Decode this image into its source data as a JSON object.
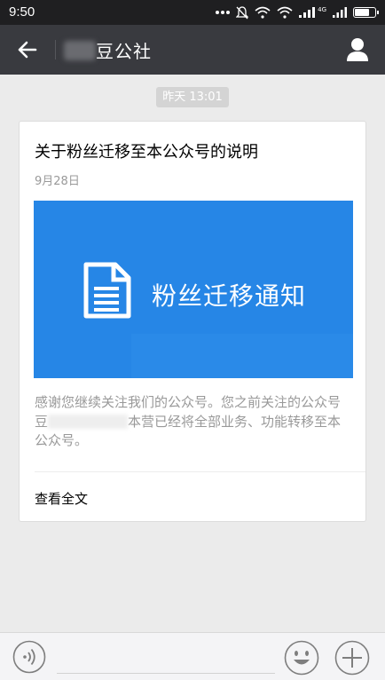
{
  "status_bar": {
    "time": "9:50",
    "signal_label": "4G",
    "battery_level_percent": 80
  },
  "navbar": {
    "title": "豆公社"
  },
  "chat": {
    "timestamp": "昨天 13:01"
  },
  "article": {
    "title": "关于粉丝迁移至本公众号的说明",
    "date": "9月28日",
    "cover_text": "粉丝迁移通知",
    "summary_part1": "感谢您继续关注我们的公众号。您之前关注的公众号豆",
    "summary_part2": "本营已经将全部业务、功能转移至本公众号。",
    "read_more": "查看全文"
  },
  "colors": {
    "navbar": "#393a3f",
    "cover_blue": "#2686e6",
    "background": "#ebebeb"
  },
  "icons": [
    "back-arrow-icon",
    "profile-icon",
    "document-icon",
    "voice-icon",
    "emoji-icon",
    "plus-icon"
  ]
}
